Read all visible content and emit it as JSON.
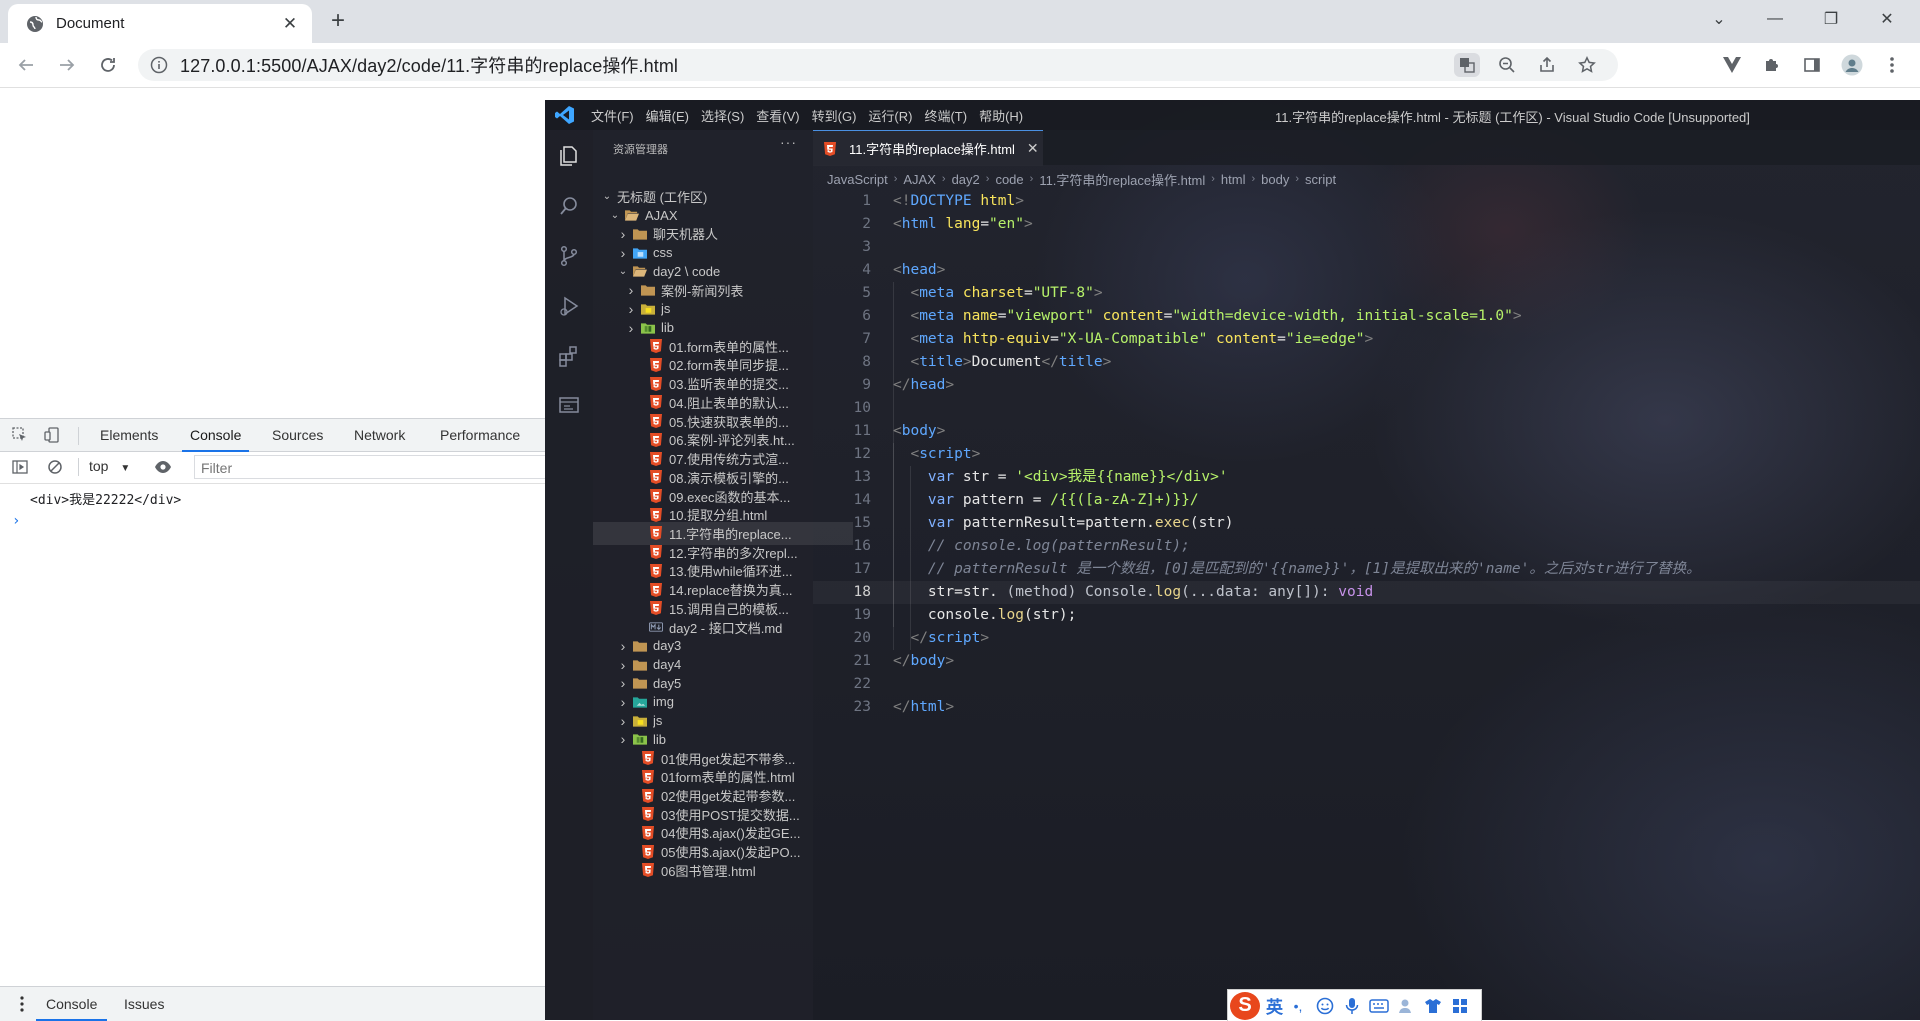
{
  "browser": {
    "tab_title": "Document",
    "url": "127.0.0.1:5500/AJAX/day2/code/11.字符串的replace操作.html"
  },
  "devtools": {
    "tabs": [
      "Elements",
      "Console",
      "Sources",
      "Network",
      "Performance"
    ],
    "active_tab": "Console",
    "context": "top",
    "filter_placeholder": "Filter",
    "console_output": "<div>我是22222</div>",
    "prompt": "›",
    "drawer_tabs": [
      "Console",
      "Issues"
    ]
  },
  "vscode": {
    "menu": [
      "文件(F)",
      "编辑(E)",
      "选择(S)",
      "查看(V)",
      "转到(G)",
      "运行(R)",
      "终端(T)",
      "帮助(H)"
    ],
    "window_title": "11.字符串的replace操作.html - 无标题 (工作区) - Visual Studio Code [Unsupported]",
    "explorer_title": "资源管理器",
    "explorer_more": "···",
    "editor_tab": "11.字符串的replace操作.html",
    "breadcrumbs": [
      "JavaScript",
      "AJAX",
      "day2",
      "code",
      "11.字符串的replace操作.html",
      "html",
      "body",
      "script"
    ],
    "tree": [
      {
        "label": "无标题 (工作区)",
        "depth": 0,
        "chev": "open",
        "icon": "none"
      },
      {
        "label": "AJAX",
        "depth": 1,
        "chev": "open",
        "icon": "folder-open"
      },
      {
        "label": "聊天机器人",
        "depth": 2,
        "chev": "closed",
        "icon": "folder"
      },
      {
        "label": "css",
        "depth": 2,
        "chev": "closed",
        "icon": "folder-css"
      },
      {
        "label": "day2 \\ code",
        "depth": 2,
        "chev": "open",
        "icon": "folder-open"
      },
      {
        "label": "案例-新闻列表",
        "depth": 3,
        "chev": "closed",
        "icon": "folder"
      },
      {
        "label": "js",
        "depth": 3,
        "chev": "closed",
        "icon": "folder-js"
      },
      {
        "label": "lib",
        "depth": 3,
        "chev": "closed",
        "icon": "folder-lib"
      },
      {
        "label": "01.form表单的属性...",
        "depth": 4,
        "chev": "none",
        "icon": "html"
      },
      {
        "label": "02.form表单同步提...",
        "depth": 4,
        "chev": "none",
        "icon": "html"
      },
      {
        "label": "03.监听表单的提交...",
        "depth": 4,
        "chev": "none",
        "icon": "html"
      },
      {
        "label": "04.阻止表单的默认...",
        "depth": 4,
        "chev": "none",
        "icon": "html"
      },
      {
        "label": "05.快速获取表单的...",
        "depth": 4,
        "chev": "none",
        "icon": "html"
      },
      {
        "label": "06.案例-评论列表.ht...",
        "depth": 4,
        "chev": "none",
        "icon": "html"
      },
      {
        "label": "07.使用传统方式渲...",
        "depth": 4,
        "chev": "none",
        "icon": "html"
      },
      {
        "label": "08.演示模板引擎的...",
        "depth": 4,
        "chev": "none",
        "icon": "html"
      },
      {
        "label": "09.exec函数的基本...",
        "depth": 4,
        "chev": "none",
        "icon": "html"
      },
      {
        "label": "10.提取分组.html",
        "depth": 4,
        "chev": "none",
        "icon": "html"
      },
      {
        "label": "11.字符串的replace...",
        "depth": 4,
        "chev": "none",
        "icon": "html",
        "selected": true
      },
      {
        "label": "12.字符串的多次repl...",
        "depth": 4,
        "chev": "none",
        "icon": "html"
      },
      {
        "label": "13.使用while循环进...",
        "depth": 4,
        "chev": "none",
        "icon": "html"
      },
      {
        "label": "14.replace替换为真...",
        "depth": 4,
        "chev": "none",
        "icon": "html"
      },
      {
        "label": "15.调用自己的模板...",
        "depth": 4,
        "chev": "none",
        "icon": "html"
      },
      {
        "label": "day2 - 接口文档.md",
        "depth": 4,
        "chev": "none",
        "icon": "md"
      },
      {
        "label": "day3",
        "depth": 2,
        "chev": "closed",
        "icon": "folder"
      },
      {
        "label": "day4",
        "depth": 2,
        "chev": "closed",
        "icon": "folder"
      },
      {
        "label": "day5",
        "depth": 2,
        "chev": "closed",
        "icon": "folder"
      },
      {
        "label": "img",
        "depth": 2,
        "chev": "closed",
        "icon": "folder-img"
      },
      {
        "label": "js",
        "depth": 2,
        "chev": "closed",
        "icon": "folder-js"
      },
      {
        "label": "lib",
        "depth": 2,
        "chev": "closed",
        "icon": "folder-lib"
      },
      {
        "label": "01使用get发起不带参...",
        "depth": 3,
        "chev": "none",
        "icon": "html"
      },
      {
        "label": "01form表单的属性.html",
        "depth": 3,
        "chev": "none",
        "icon": "html"
      },
      {
        "label": "02使用get发起带参数...",
        "depth": 3,
        "chev": "none",
        "icon": "html"
      },
      {
        "label": "03使用POST提交数据...",
        "depth": 3,
        "chev": "none",
        "icon": "html"
      },
      {
        "label": "04使用$.ajax()发起GE...",
        "depth": 3,
        "chev": "none",
        "icon": "html"
      },
      {
        "label": "05使用$.ajax()发起PO...",
        "depth": 3,
        "chev": "none",
        "icon": "html"
      },
      {
        "label": "06图书管理.html",
        "depth": 3,
        "chev": "none",
        "icon": "html"
      }
    ],
    "current_line": 18,
    "code": [
      [
        [
          "t-brk",
          "<!"
        ],
        [
          "t-tag",
          "DOCTYPE"
        ],
        [
          "t-plain",
          " "
        ],
        [
          "t-attr",
          "html"
        ],
        [
          "t-brk",
          ">"
        ]
      ],
      [
        [
          "t-brk",
          "<"
        ],
        [
          "t-tag",
          "html"
        ],
        [
          "t-plain",
          " "
        ],
        [
          "t-attr",
          "lang"
        ],
        [
          "t-plain",
          "="
        ],
        [
          "t-str",
          "\"en\""
        ],
        [
          "t-brk",
          ">"
        ]
      ],
      [],
      [
        [
          "t-brk",
          "<"
        ],
        [
          "t-tag",
          "head"
        ],
        [
          "t-brk",
          ">"
        ]
      ],
      [
        [
          "t-plain",
          "  "
        ],
        [
          "t-brk",
          "<"
        ],
        [
          "t-tag",
          "meta"
        ],
        [
          "t-plain",
          " "
        ],
        [
          "t-attr",
          "charset"
        ],
        [
          "t-plain",
          "="
        ],
        [
          "t-str",
          "\"UTF-8\""
        ],
        [
          "t-brk",
          ">"
        ]
      ],
      [
        [
          "t-plain",
          "  "
        ],
        [
          "t-brk",
          "<"
        ],
        [
          "t-tag",
          "meta"
        ],
        [
          "t-plain",
          " "
        ],
        [
          "t-attr",
          "name"
        ],
        [
          "t-plain",
          "="
        ],
        [
          "t-str",
          "\"viewport\""
        ],
        [
          "t-plain",
          " "
        ],
        [
          "t-attr",
          "content"
        ],
        [
          "t-plain",
          "="
        ],
        [
          "t-str",
          "\"width=device-width, initial-scale=1.0\""
        ],
        [
          "t-brk",
          ">"
        ]
      ],
      [
        [
          "t-plain",
          "  "
        ],
        [
          "t-brk",
          "<"
        ],
        [
          "t-tag",
          "meta"
        ],
        [
          "t-plain",
          " "
        ],
        [
          "t-attr",
          "http-equiv"
        ],
        [
          "t-plain",
          "="
        ],
        [
          "t-str",
          "\"X-UA-Compatible\""
        ],
        [
          "t-plain",
          " "
        ],
        [
          "t-attr",
          "content"
        ],
        [
          "t-plain",
          "="
        ],
        [
          "t-str",
          "\"ie=edge\""
        ],
        [
          "t-brk",
          ">"
        ]
      ],
      [
        [
          "t-plain",
          "  "
        ],
        [
          "t-brk",
          "<"
        ],
        [
          "t-tag",
          "title"
        ],
        [
          "t-brk",
          ">"
        ],
        [
          "t-plain",
          "Document"
        ],
        [
          "t-brk",
          "</"
        ],
        [
          "t-tag",
          "title"
        ],
        [
          "t-brk",
          ">"
        ]
      ],
      [
        [
          "t-brk",
          "</"
        ],
        [
          "t-tag",
          "head"
        ],
        [
          "t-brk",
          ">"
        ]
      ],
      [],
      [
        [
          "t-brk",
          "<"
        ],
        [
          "t-tag",
          "body"
        ],
        [
          "t-brk",
          ">"
        ]
      ],
      [
        [
          "t-plain",
          "  "
        ],
        [
          "t-brk",
          "<"
        ],
        [
          "t-tag",
          "script"
        ],
        [
          "t-brk",
          ">"
        ]
      ],
      [
        [
          "t-plain",
          "    "
        ],
        [
          "t-kw",
          "var"
        ],
        [
          "t-plain",
          " str = "
        ],
        [
          "t-str",
          "'<div>我是{{name}}</div>'"
        ]
      ],
      [
        [
          "t-plain",
          "    "
        ],
        [
          "t-kw",
          "var"
        ],
        [
          "t-plain",
          " pattern = "
        ],
        [
          "t-str",
          "/{{([a-zA-Z]+)}}/"
        ]
      ],
      [
        [
          "t-plain",
          "    "
        ],
        [
          "t-kw",
          "var"
        ],
        [
          "t-plain",
          " patternResult=pattern."
        ],
        [
          "t-fn",
          "exec"
        ],
        [
          "t-plain",
          "(str)"
        ]
      ],
      [
        [
          "t-plain",
          "    "
        ],
        [
          "t-com",
          "// console.log(patternResult);"
        ]
      ],
      [
        [
          "t-plain",
          "    "
        ],
        [
          "t-com",
          "// patternResult 是一个数组，[0]是匹配到的'{{name}}'，[1]是提取出来的'name'。之后对str进行了替换。"
        ]
      ],
      [
        [
          "t-plain",
          "    str=str. "
        ],
        [
          "t-hint",
          "(method) Console."
        ],
        [
          "t-fn",
          "log"
        ],
        [
          "t-hint",
          "(...data: any[]): "
        ],
        [
          "t-void",
          "void"
        ]
      ],
      [
        [
          "t-plain",
          "    console."
        ],
        [
          "t-fn",
          "log"
        ],
        [
          "t-plain",
          "(str);"
        ]
      ],
      [
        [
          "t-plain",
          "  "
        ],
        [
          "t-brk",
          "</"
        ],
        [
          "t-tag",
          "script"
        ],
        [
          "t-brk",
          ">"
        ]
      ],
      [
        [
          "t-brk",
          "</"
        ],
        [
          "t-tag",
          "body"
        ],
        [
          "t-brk",
          ">"
        ]
      ],
      [],
      [
        [
          "t-brk",
          "</"
        ],
        [
          "t-tag",
          "html"
        ],
        [
          "t-brk",
          ">"
        ]
      ]
    ]
  },
  "ime": {
    "lang": "英",
    "punct": "•,"
  }
}
